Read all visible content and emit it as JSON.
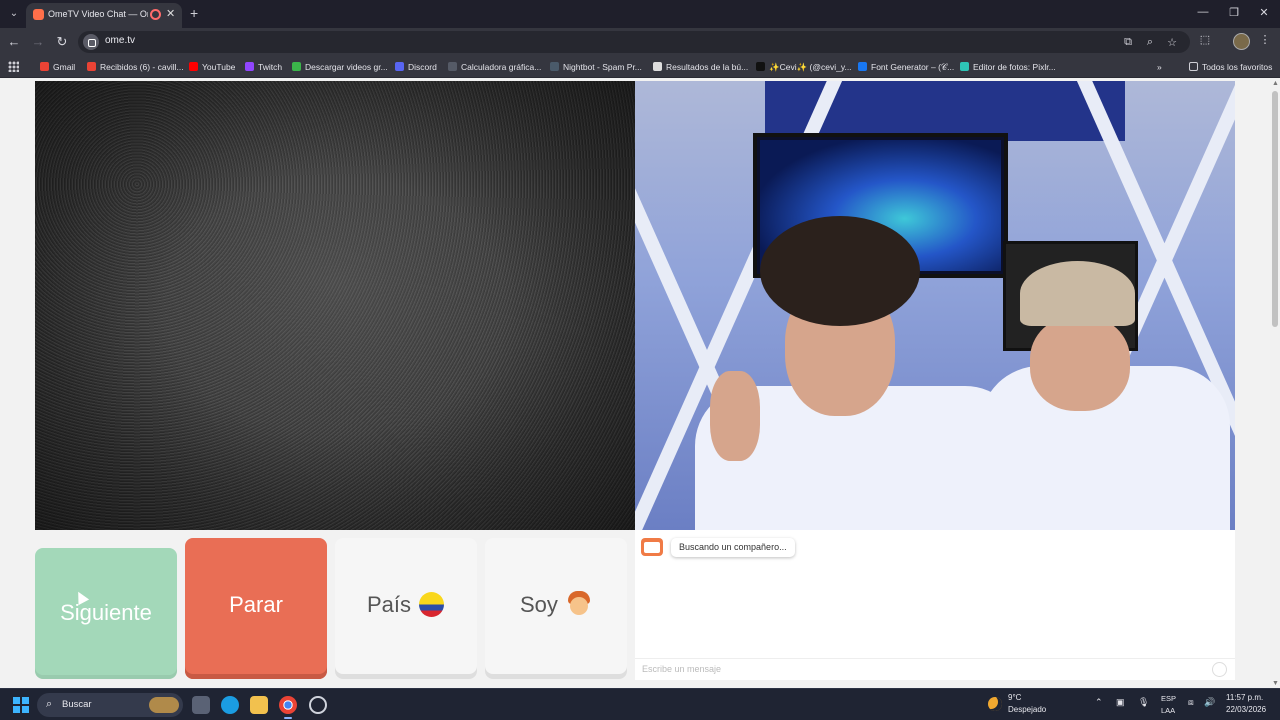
{
  "browser": {
    "tab_title": "OmeTV Video Chat — Ome",
    "url": "ome.tv",
    "bookmarks": [
      {
        "label": "Gmail",
        "color": "#ea4335"
      },
      {
        "label": "Recibidos (6) - cavill...",
        "color": "#ea4335"
      },
      {
        "label": "YouTube",
        "color": "#ff0000"
      },
      {
        "label": "Twitch",
        "color": "#9146ff"
      },
      {
        "label": "Descargar videos gr...",
        "color": "#3bb54a"
      },
      {
        "label": "Discord",
        "color": "#5865f2"
      },
      {
        "label": "Calculadora gráfica...",
        "color": "#555a66"
      },
      {
        "label": "Nightbot - Spam Pr...",
        "color": "#2a3a4a"
      },
      {
        "label": "Resultados de la bú...",
        "color": "#dddddd"
      },
      {
        "label": "✨Cevi✨ (@cevi_y...",
        "color": "#111111"
      },
      {
        "label": "Font Generator – (𝒞...",
        "color": "#1877f2"
      },
      {
        "label": "Editor de fotos: Pixlr...",
        "color": "#2ec4b6"
      }
    ],
    "all_bookmarks": "Todos los favoritos"
  },
  "controls": {
    "next_label": "Siguiente",
    "stop_label": "Parar",
    "country_label": "País",
    "gender_label": "Soy"
  },
  "chat": {
    "status_message": "Buscando un compañero...",
    "input_placeholder": "Escribe un mensaje"
  },
  "taskbar": {
    "search_label": "Buscar",
    "weather_temp": "9°C",
    "weather_desc": "Despejado",
    "lang_line1": "ESP",
    "lang_line2": "LAA",
    "time": "11:57 p.m.",
    "date": "22/03/2026"
  },
  "colors": {
    "next_button": "#a3d8b9",
    "stop_button": "#e96e55",
    "accent_logo": "#f07b46"
  }
}
